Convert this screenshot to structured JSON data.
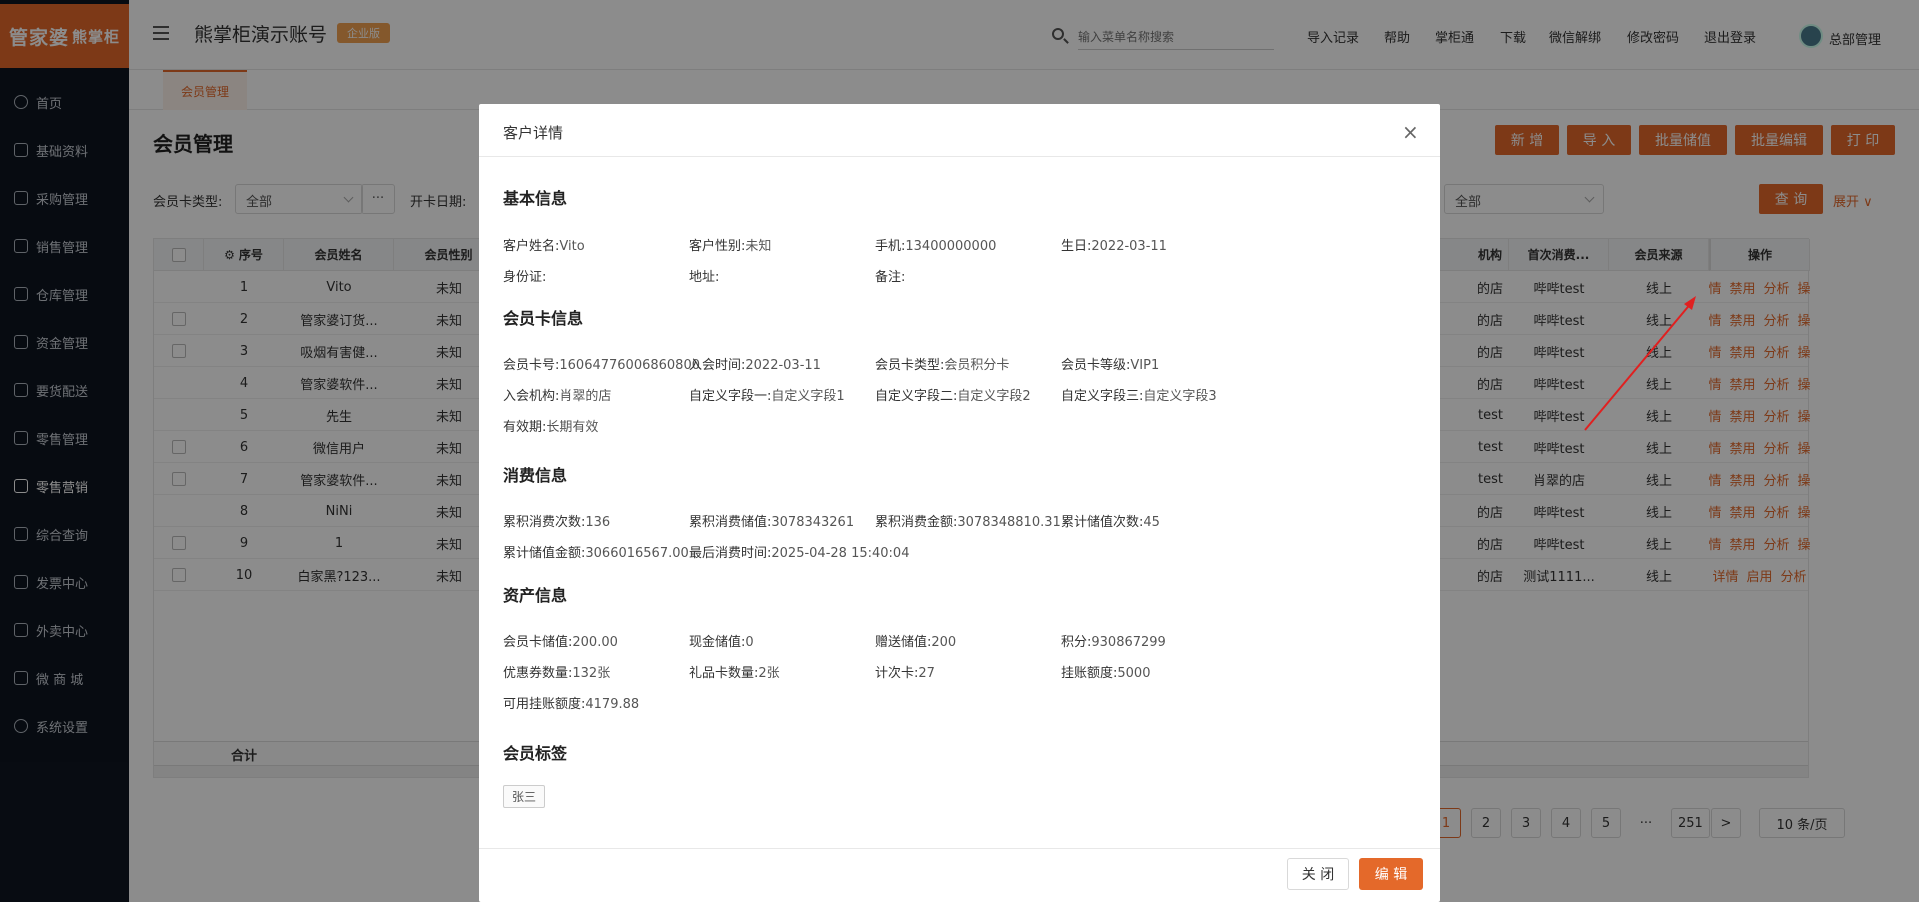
{
  "brand": {
    "logo_main": "管家婆",
    "logo_sub": "熊掌柜"
  },
  "sidebar": {
    "items": [
      {
        "label": "首页"
      },
      {
        "label": "基础资料"
      },
      {
        "label": "采购管理"
      },
      {
        "label": "销售管理"
      },
      {
        "label": "仓库管理"
      },
      {
        "label": "资金管理"
      },
      {
        "label": "要货配送"
      },
      {
        "label": "零售管理"
      },
      {
        "label": "零售营销"
      },
      {
        "label": "综合查询"
      },
      {
        "label": "发票中心"
      },
      {
        "label": "外卖中心"
      },
      {
        "label": "微 商 城"
      },
      {
        "label": "系统设置"
      }
    ]
  },
  "header": {
    "account_name": "熊掌柜演示账号",
    "edition_badge": "企业版",
    "search_placeholder": "输入菜单名称搜索",
    "links": [
      "导入记录",
      "帮助",
      "掌柜通",
      "下载",
      "微信解绑",
      "修改密码",
      "退出登录"
    ],
    "user": "总部管理"
  },
  "tabs": {
    "active": "会员管理"
  },
  "page": {
    "title": "会员管理",
    "buttons": [
      "新 增",
      "导 入",
      "批量储值",
      "批量编辑",
      "打 印"
    ],
    "filters": {
      "card_type_label": "会员卡类型:",
      "card_type_value": "全部",
      "more": "···",
      "open_date_label": "开卡日期:",
      "right_select_value": "全部",
      "query_button": "查 询",
      "expand": "展开"
    }
  },
  "table": {
    "headers": {
      "seq": "序号",
      "name": "会员姓名",
      "gender": "会员性别",
      "org": "机构",
      "first_consume": "首次消费...",
      "source": "会员来源",
      "ops": "操作"
    },
    "rows": [
      {
        "seq": "1",
        "name": "Vito",
        "gender": "未知",
        "org": "的店",
        "first": "哔哔test",
        "source": "线上",
        "ops": [
          "详情",
          "禁用",
          "分析",
          "操作"
        ]
      },
      {
        "seq": "2",
        "name": "管家婆订货...",
        "gender": "未知",
        "org": "的店",
        "first": "哔哔test",
        "source": "线上",
        "ops": [
          "详情",
          "禁用",
          "分析",
          "操作"
        ]
      },
      {
        "seq": "3",
        "name": "吸烟有害健...",
        "gender": "未知",
        "org": "的店",
        "first": "哔哔test",
        "source": "线上",
        "ops": [
          "详情",
          "禁用",
          "分析",
          "操作"
        ]
      },
      {
        "seq": "4",
        "name": "管家婆软件...",
        "gender": "未知",
        "org": "的店",
        "first": "哔哔test",
        "source": "线上",
        "ops": [
          "详情",
          "禁用",
          "分析",
          "操作"
        ]
      },
      {
        "seq": "5",
        "name": "先生",
        "gender": "未知",
        "org": "test",
        "first": "哔哔test",
        "source": "线上",
        "ops": [
          "详情",
          "禁用",
          "分析",
          "操作"
        ]
      },
      {
        "seq": "6",
        "name": "微信用户",
        "gender": "未知",
        "org": "test",
        "first": "哔哔test",
        "source": "线上",
        "ops": [
          "详情",
          "禁用",
          "分析",
          "操作"
        ]
      },
      {
        "seq": "7",
        "name": "管家婆软件...",
        "gender": "未知",
        "org": "test",
        "first": "肖翠的店",
        "source": "线上",
        "ops": [
          "详情",
          "禁用",
          "分析",
          "操作"
        ]
      },
      {
        "seq": "8",
        "name": "NiNi",
        "gender": "未知",
        "org": "的店",
        "first": "哔哔test",
        "source": "线上",
        "ops": [
          "详情",
          "禁用",
          "分析",
          "操作"
        ]
      },
      {
        "seq": "9",
        "name": "1",
        "gender": "未知",
        "org": "的店",
        "first": "哔哔test",
        "source": "线上",
        "ops": [
          "详情",
          "禁用",
          "分析",
          "操作"
        ]
      },
      {
        "seq": "10",
        "name": "白家黑?123...",
        "gender": "未知",
        "org": "的店",
        "first": "测试1111...",
        "source": "线上",
        "ops": [
          "详情",
          "启用",
          "分析"
        ]
      }
    ],
    "total_label": "合计"
  },
  "pagination": {
    "pages": [
      "1",
      "2",
      "3",
      "4",
      "5",
      "···",
      "251"
    ],
    "active": "1",
    "next": ">",
    "page_size": "10 条/页"
  },
  "modal": {
    "title": "客户详情",
    "close_icon": "×",
    "sections": {
      "basic": {
        "title": "基本信息",
        "fields": [
          {
            "label": "客户姓名:",
            "value": "Vito"
          },
          {
            "label": "客户性别:",
            "value": "未知"
          },
          {
            "label": "手机:",
            "value": "13400000000"
          },
          {
            "label": "生日:",
            "value": "2022-03-11"
          },
          {
            "label": "身份证:",
            "value": ""
          },
          {
            "label": "地址:",
            "value": ""
          },
          {
            "label": "备注:",
            "value": ""
          }
        ]
      },
      "card": {
        "title": "会员卡信息",
        "fields": [
          {
            "label": "会员卡号:",
            "value": "16064776006860800"
          },
          {
            "label": "入会时间:",
            "value": "2022-03-11"
          },
          {
            "label": "会员卡类型:",
            "value": "会员积分卡"
          },
          {
            "label": "会员卡等级:",
            "value": "VIP1"
          },
          {
            "label": "入会机构:",
            "value": "肖翠的店"
          },
          {
            "label": "自定义字段一:",
            "value": "自定义字段1"
          },
          {
            "label": "自定义字段二:",
            "value": "自定义字段2"
          },
          {
            "label": "自定义字段三:",
            "value": "自定义字段3"
          },
          {
            "label": "有效期:",
            "value": "长期有效"
          }
        ]
      },
      "consume": {
        "title": "消费信息",
        "fields": [
          {
            "label": "累积消费次数:",
            "value": "136"
          },
          {
            "label": "累积消费储值:",
            "value": "3078343261"
          },
          {
            "label": "累积消费金额:",
            "value": "3078348810.31"
          },
          {
            "label": "累计储值次数:",
            "value": "45"
          },
          {
            "label": "累计储值金额:",
            "value": "3066016567.00"
          },
          {
            "label": "最后消费时间:",
            "value": "2025-04-28 15:40:04"
          }
        ]
      },
      "assets": {
        "title": "资产信息",
        "fields": [
          {
            "label": "会员卡储值:",
            "value": "200.00"
          },
          {
            "label": "现金储值:",
            "value": "0"
          },
          {
            "label": "赠送储值:",
            "value": "200"
          },
          {
            "label": "积分:",
            "value": "930867299"
          },
          {
            "label": "优惠券数量:",
            "value": "132张"
          },
          {
            "label": "礼品卡数量:",
            "value": "2张"
          },
          {
            "label": "计次卡:",
            "value": "27"
          },
          {
            "label": "挂账额度:",
            "value": "5000"
          },
          {
            "label": "可用挂账额度:",
            "value": "4179.88"
          }
        ]
      },
      "tags": {
        "title": "会员标签",
        "items": [
          "张三"
        ]
      }
    },
    "close_button": "关 闭",
    "edit_button": "编 辑"
  }
}
